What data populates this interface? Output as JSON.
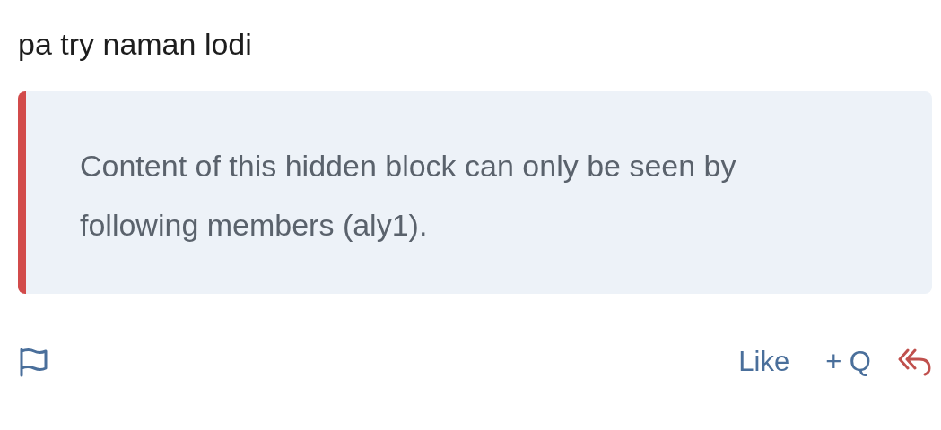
{
  "post": {
    "text": "pa try naman lodi"
  },
  "hidden_block": {
    "text": "Content of this hidden block can only be seen by following members (aly1)."
  },
  "actions": {
    "like": "Like",
    "quote": "+ Q"
  }
}
